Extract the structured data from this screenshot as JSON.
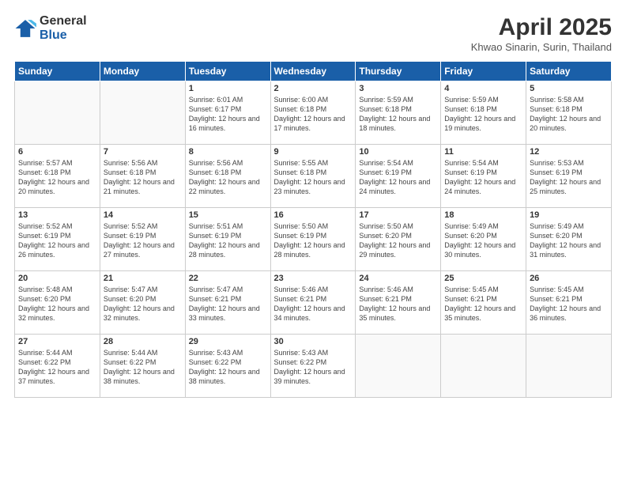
{
  "logo": {
    "general": "General",
    "blue": "Blue"
  },
  "title": "April 2025",
  "subtitle": "Khwao Sinarin, Surin, Thailand",
  "headers": [
    "Sunday",
    "Monday",
    "Tuesday",
    "Wednesday",
    "Thursday",
    "Friday",
    "Saturday"
  ],
  "weeks": [
    [
      {
        "day": "",
        "info": ""
      },
      {
        "day": "",
        "info": ""
      },
      {
        "day": "1",
        "info": "Sunrise: 6:01 AM\nSunset: 6:17 PM\nDaylight: 12 hours and 16 minutes."
      },
      {
        "day": "2",
        "info": "Sunrise: 6:00 AM\nSunset: 6:18 PM\nDaylight: 12 hours and 17 minutes."
      },
      {
        "day": "3",
        "info": "Sunrise: 5:59 AM\nSunset: 6:18 PM\nDaylight: 12 hours and 18 minutes."
      },
      {
        "day": "4",
        "info": "Sunrise: 5:59 AM\nSunset: 6:18 PM\nDaylight: 12 hours and 19 minutes."
      },
      {
        "day": "5",
        "info": "Sunrise: 5:58 AM\nSunset: 6:18 PM\nDaylight: 12 hours and 20 minutes."
      }
    ],
    [
      {
        "day": "6",
        "info": "Sunrise: 5:57 AM\nSunset: 6:18 PM\nDaylight: 12 hours and 20 minutes."
      },
      {
        "day": "7",
        "info": "Sunrise: 5:56 AM\nSunset: 6:18 PM\nDaylight: 12 hours and 21 minutes."
      },
      {
        "day": "8",
        "info": "Sunrise: 5:56 AM\nSunset: 6:18 PM\nDaylight: 12 hours and 22 minutes."
      },
      {
        "day": "9",
        "info": "Sunrise: 5:55 AM\nSunset: 6:18 PM\nDaylight: 12 hours and 23 minutes."
      },
      {
        "day": "10",
        "info": "Sunrise: 5:54 AM\nSunset: 6:19 PM\nDaylight: 12 hours and 24 minutes."
      },
      {
        "day": "11",
        "info": "Sunrise: 5:54 AM\nSunset: 6:19 PM\nDaylight: 12 hours and 24 minutes."
      },
      {
        "day": "12",
        "info": "Sunrise: 5:53 AM\nSunset: 6:19 PM\nDaylight: 12 hours and 25 minutes."
      }
    ],
    [
      {
        "day": "13",
        "info": "Sunrise: 5:52 AM\nSunset: 6:19 PM\nDaylight: 12 hours and 26 minutes."
      },
      {
        "day": "14",
        "info": "Sunrise: 5:52 AM\nSunset: 6:19 PM\nDaylight: 12 hours and 27 minutes."
      },
      {
        "day": "15",
        "info": "Sunrise: 5:51 AM\nSunset: 6:19 PM\nDaylight: 12 hours and 28 minutes."
      },
      {
        "day": "16",
        "info": "Sunrise: 5:50 AM\nSunset: 6:19 PM\nDaylight: 12 hours and 28 minutes."
      },
      {
        "day": "17",
        "info": "Sunrise: 5:50 AM\nSunset: 6:20 PM\nDaylight: 12 hours and 29 minutes."
      },
      {
        "day": "18",
        "info": "Sunrise: 5:49 AM\nSunset: 6:20 PM\nDaylight: 12 hours and 30 minutes."
      },
      {
        "day": "19",
        "info": "Sunrise: 5:49 AM\nSunset: 6:20 PM\nDaylight: 12 hours and 31 minutes."
      }
    ],
    [
      {
        "day": "20",
        "info": "Sunrise: 5:48 AM\nSunset: 6:20 PM\nDaylight: 12 hours and 32 minutes."
      },
      {
        "day": "21",
        "info": "Sunrise: 5:47 AM\nSunset: 6:20 PM\nDaylight: 12 hours and 32 minutes."
      },
      {
        "day": "22",
        "info": "Sunrise: 5:47 AM\nSunset: 6:21 PM\nDaylight: 12 hours and 33 minutes."
      },
      {
        "day": "23",
        "info": "Sunrise: 5:46 AM\nSunset: 6:21 PM\nDaylight: 12 hours and 34 minutes."
      },
      {
        "day": "24",
        "info": "Sunrise: 5:46 AM\nSunset: 6:21 PM\nDaylight: 12 hours and 35 minutes."
      },
      {
        "day": "25",
        "info": "Sunrise: 5:45 AM\nSunset: 6:21 PM\nDaylight: 12 hours and 35 minutes."
      },
      {
        "day": "26",
        "info": "Sunrise: 5:45 AM\nSunset: 6:21 PM\nDaylight: 12 hours and 36 minutes."
      }
    ],
    [
      {
        "day": "27",
        "info": "Sunrise: 5:44 AM\nSunset: 6:22 PM\nDaylight: 12 hours and 37 minutes."
      },
      {
        "day": "28",
        "info": "Sunrise: 5:44 AM\nSunset: 6:22 PM\nDaylight: 12 hours and 38 minutes."
      },
      {
        "day": "29",
        "info": "Sunrise: 5:43 AM\nSunset: 6:22 PM\nDaylight: 12 hours and 38 minutes."
      },
      {
        "day": "30",
        "info": "Sunrise: 5:43 AM\nSunset: 6:22 PM\nDaylight: 12 hours and 39 minutes."
      },
      {
        "day": "",
        "info": ""
      },
      {
        "day": "",
        "info": ""
      },
      {
        "day": "",
        "info": ""
      }
    ]
  ]
}
